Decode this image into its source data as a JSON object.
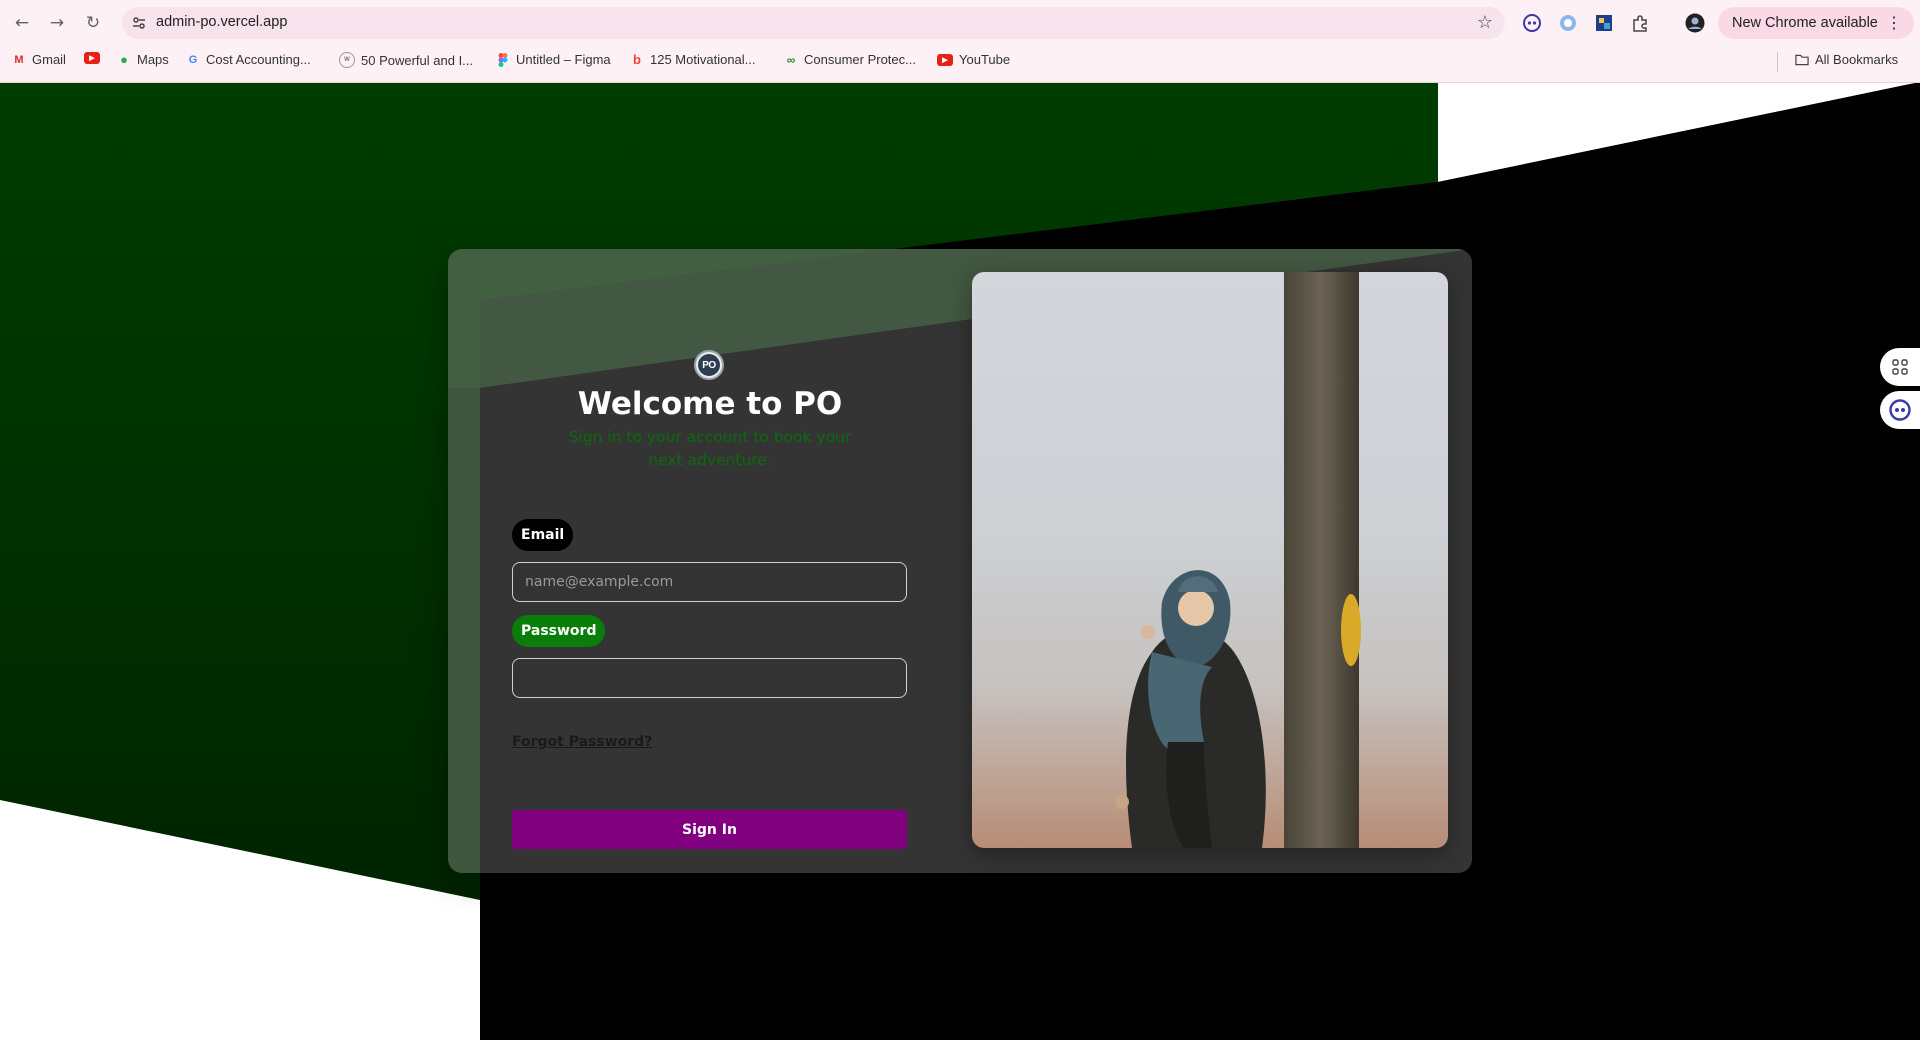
{
  "browser": {
    "url": "admin-po.vercel.app",
    "new_chrome_label": "New Chrome available",
    "bookmarks": [
      {
        "label": "Gmail",
        "icon": "gmail-icon"
      },
      {
        "label": "",
        "icon": "youtube-icon"
      },
      {
        "label": "Maps",
        "icon": "maps-icon"
      },
      {
        "label": "Cost Accounting...",
        "icon": "google-icon"
      },
      {
        "label": "50 Powerful and I...",
        "icon": "site-icon"
      },
      {
        "label": "Untitled – Figma",
        "icon": "figma-icon"
      },
      {
        "label": "125 Motivational...",
        "icon": "site-icon"
      },
      {
        "label": "Consumer Protec...",
        "icon": "site-icon"
      },
      {
        "label": "YouTube",
        "icon": "youtube-icon"
      }
    ],
    "all_bookmarks": "All Bookmarks"
  },
  "login": {
    "logo_text": "PO",
    "title": "Welcome to PO",
    "subtitle": "Sign in to your account to book your next adventure.",
    "email_label": "Email",
    "email_placeholder": "name@example.com",
    "password_label": "Password",
    "forgot_password": "Forgot Password?",
    "sign_in": "Sign In"
  },
  "colors": {
    "background_green": "#003a00",
    "sign_in_button": "#800080",
    "password_label_bg": "#0a7d0a",
    "subtitle_text": "#0b6b0b"
  }
}
